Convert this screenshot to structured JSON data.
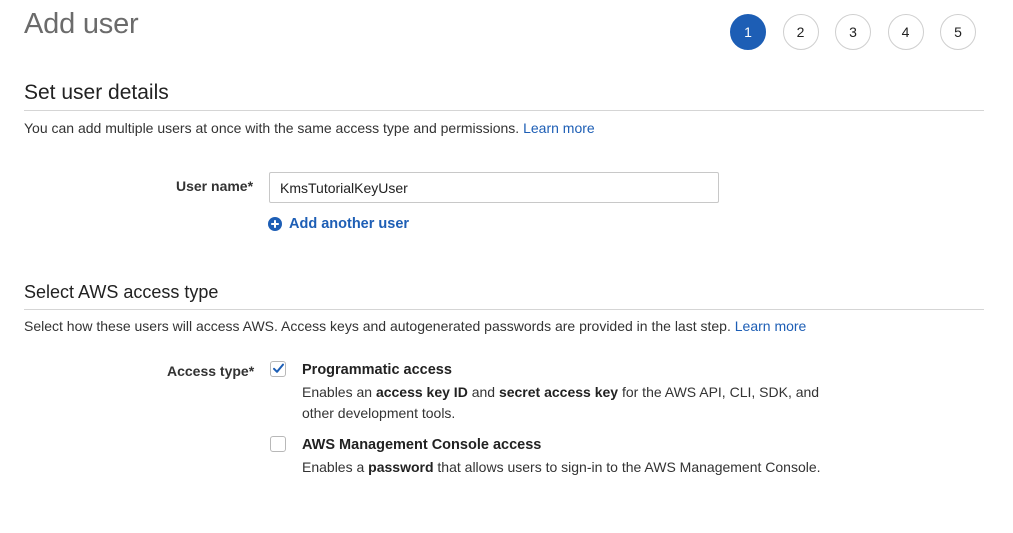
{
  "header": {
    "title": "Add user",
    "steps": [
      "1",
      "2",
      "3",
      "4",
      "5"
    ],
    "active_step": "1"
  },
  "details": {
    "title": "Set user details",
    "description": "You can add multiple users at once with the same access type and permissions.",
    "learn_more": "Learn more",
    "user_name_label": "User name*",
    "user_name_value": "KmsTutorialKeyUser",
    "add_another_label": "Add another user"
  },
  "access": {
    "title": "Select AWS access type",
    "description": "Select how these users will access AWS. Access keys and autogenerated passwords are provided in the last step.",
    "learn_more": "Learn more",
    "access_type_label": "Access type*",
    "programmatic": {
      "label": "Programmatic access",
      "checked": true,
      "desc_1": "Enables an ",
      "desc_2": "access key ID",
      "desc_3": " and ",
      "desc_4": "secret access key",
      "desc_5": " for the AWS API, CLI, SDK, and other development tools."
    },
    "console": {
      "label": "AWS Management Console access",
      "checked": false,
      "desc_1": "Enables a ",
      "desc_2": "password",
      "desc_3": " that allows users to sign-in to the AWS Management Console."
    }
  },
  "colors": {
    "accent": "#1d5eb5",
    "title_gray": "#6b6b6b",
    "rule": "#d5d5d5"
  }
}
